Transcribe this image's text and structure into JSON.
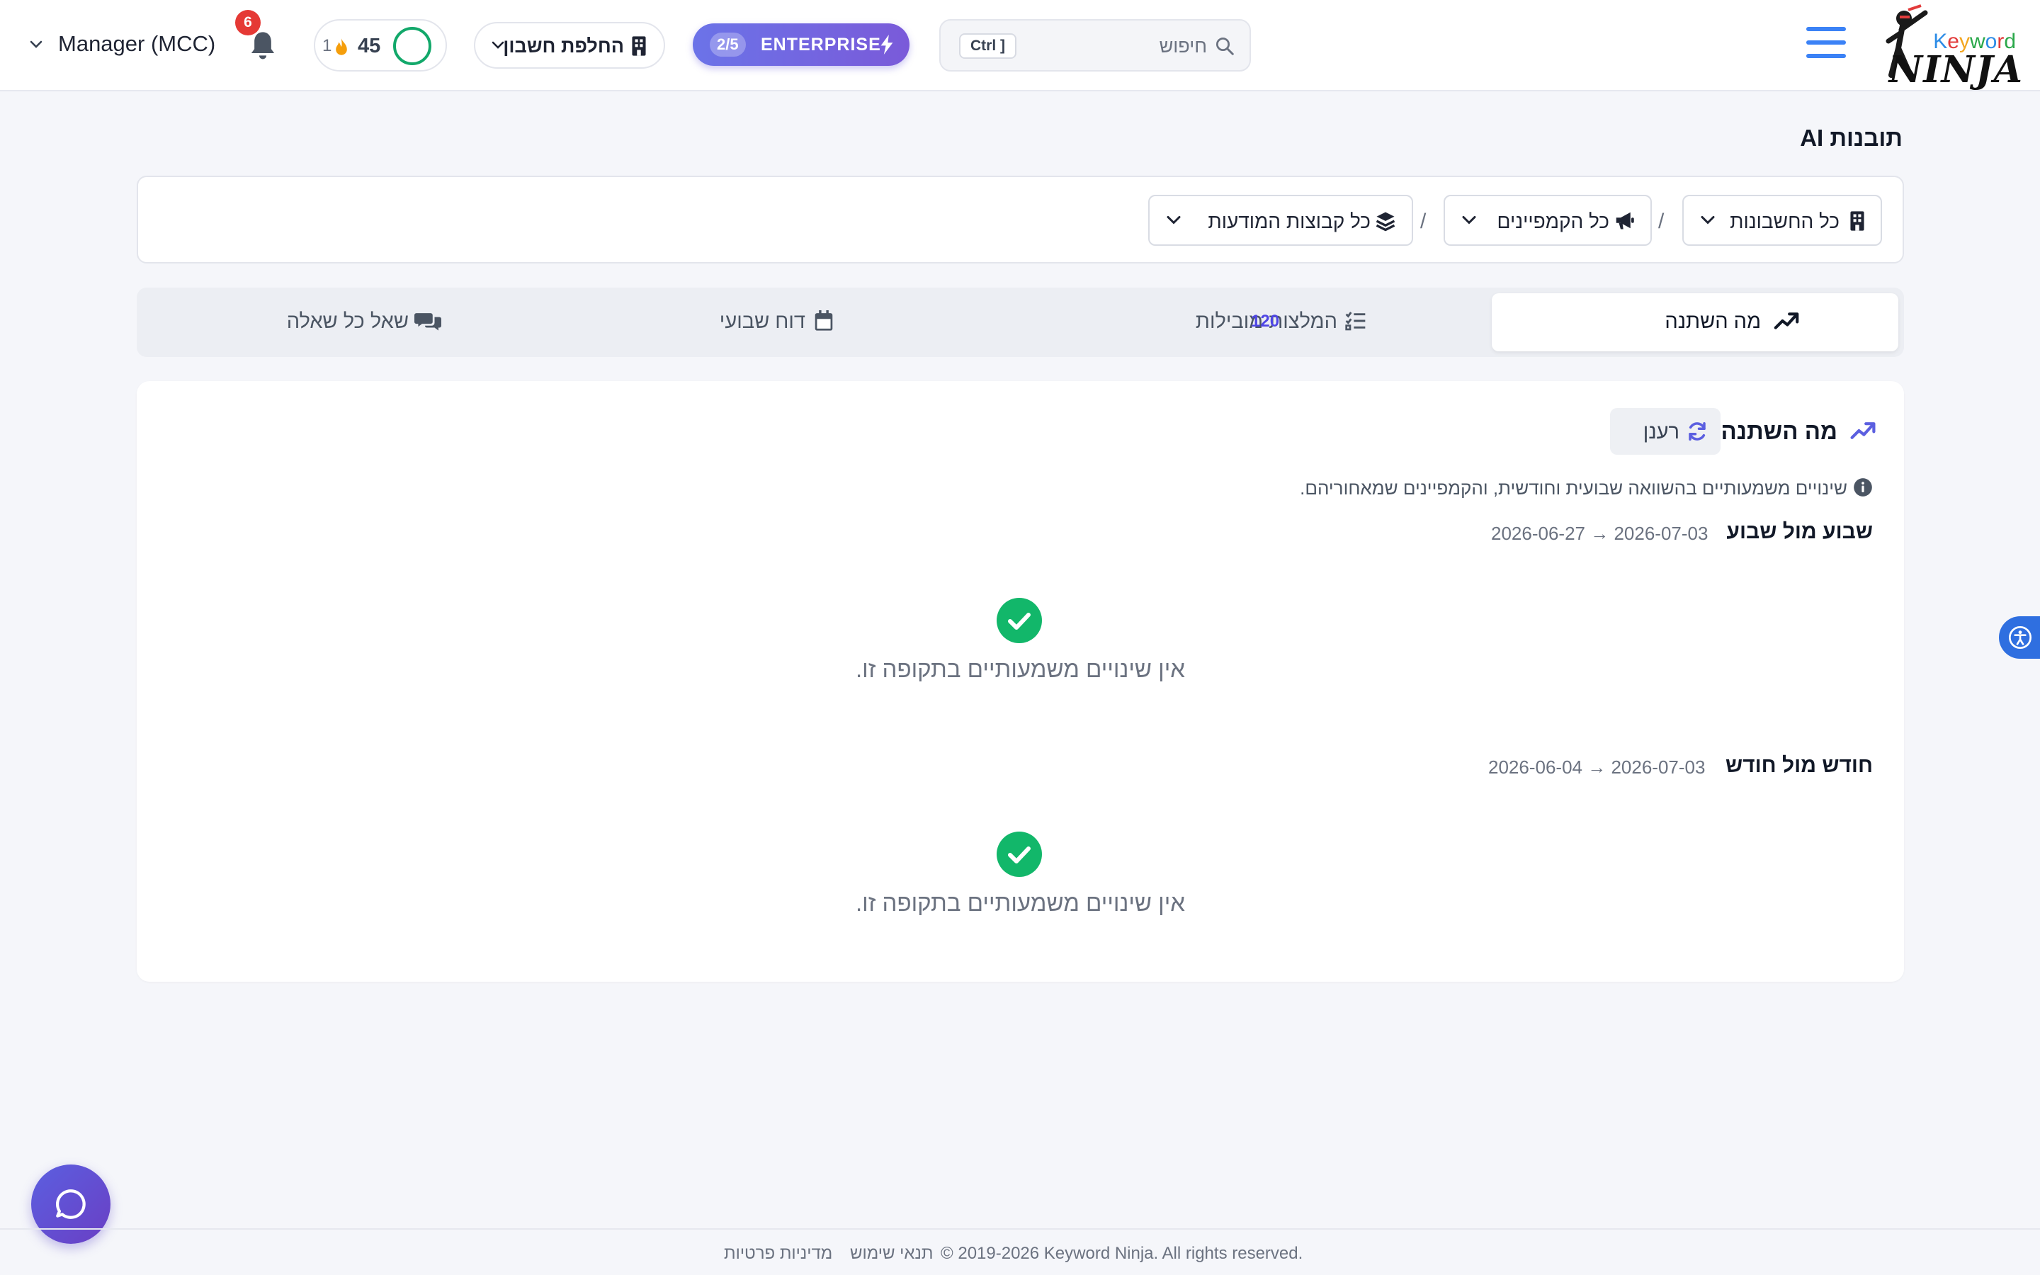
{
  "header": {
    "logo_text_top": "Keyword",
    "logo_text_bottom": "NINJA",
    "search_placeholder": "חיפוש",
    "search_shortcut": "Ctrl ]",
    "plan_label": "ENTERPRISE",
    "plan_usage": "2/5",
    "switch_account_label": "החלפת חשבון",
    "score_value": "45",
    "streak_value": "1",
    "notifications_count": "6",
    "account_name": "Manager (MCC)"
  },
  "page": {
    "title": "תובנות AI"
  },
  "filters": {
    "accounts": "כל החשבונות",
    "campaigns": "כל הקמפיינים",
    "ad_groups": "כל קבוצות המודעות",
    "separator": "/"
  },
  "tabs": [
    {
      "label": "מה השתנה",
      "active": true
    },
    {
      "label": "המלצות מובילות",
      "count": "120"
    },
    {
      "label": "דוח שבועי"
    },
    {
      "label": "שאל כל שאלה"
    }
  ],
  "card": {
    "title": "מה השתנה",
    "refresh_label": "רענן",
    "subtitle": "שינויים משמעותיים בהשוואה שבועית וחודשית, והקמפיינים שמאחוריהם.",
    "periods": [
      {
        "title": "שבוע מול שבוע",
        "range": "2026-06-27 → 2026-07-03",
        "empty_message": "אין שינויים משמעותיים בתקופה זו."
      },
      {
        "title": "חודש מול חודש",
        "range": "2026-06-04 → 2026-07-03",
        "empty_message": "אין שינויים משמעותיים בתקופה זו."
      }
    ]
  },
  "footer": {
    "copyright": "© 2019-2026 Keyword Ninja. All rights reserved.",
    "terms": "תנאי שימוש",
    "privacy": "מדיניות פרטיות"
  },
  "colors": {
    "accent": "#4f46e5",
    "success": "#12b76a",
    "brand_gradient_start": "#6b73e8",
    "notification": "#e53935"
  }
}
